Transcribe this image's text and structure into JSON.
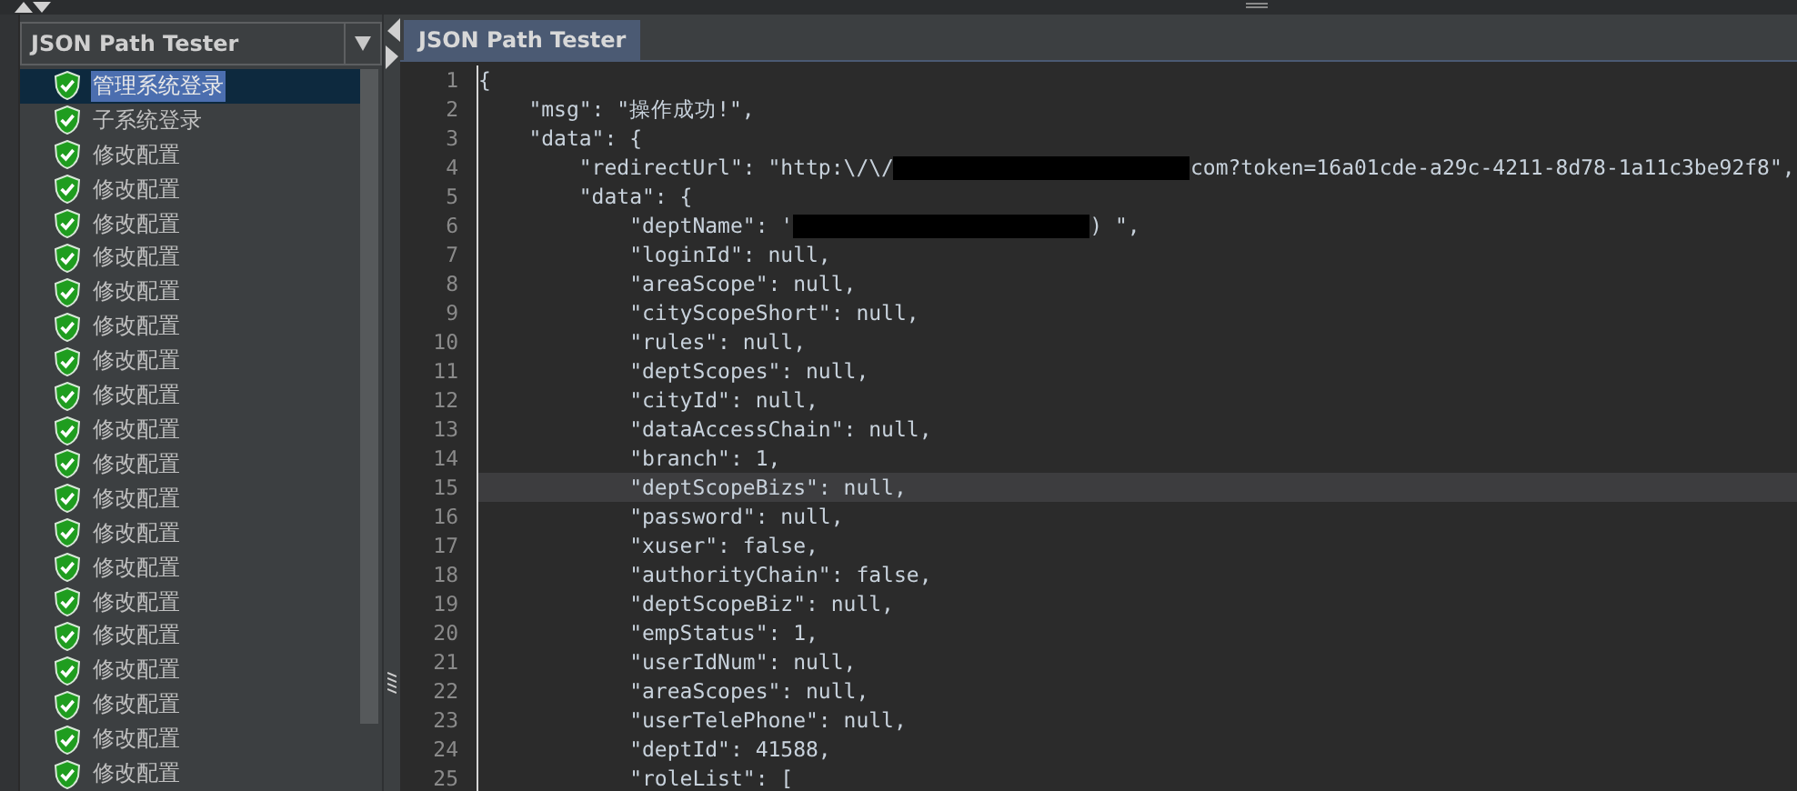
{
  "left_panel": {
    "dropdown": {
      "value": "JSON Path Tester"
    },
    "tree_items": [
      {
        "label": "管理系统登录",
        "selected": true
      },
      {
        "label": "子系统登录",
        "selected": false
      },
      {
        "label": "修改配置",
        "selected": false
      },
      {
        "label": "修改配置",
        "selected": false
      },
      {
        "label": "修改配置",
        "selected": false
      },
      {
        "label": "修改配置",
        "selected": false
      },
      {
        "label": "修改配置",
        "selected": false
      },
      {
        "label": "修改配置",
        "selected": false
      },
      {
        "label": "修改配置",
        "selected": false
      },
      {
        "label": "修改配置",
        "selected": false
      },
      {
        "label": "修改配置",
        "selected": false
      },
      {
        "label": "修改配置",
        "selected": false
      },
      {
        "label": "修改配置",
        "selected": false
      },
      {
        "label": "修改配置",
        "selected": false
      },
      {
        "label": "修改配置",
        "selected": false
      },
      {
        "label": "修改配置",
        "selected": false
      },
      {
        "label": "修改配置",
        "selected": false
      },
      {
        "label": "修改配置",
        "selected": false
      },
      {
        "label": "修改配置",
        "selected": false
      },
      {
        "label": "修改配置",
        "selected": false
      },
      {
        "label": "修改配置",
        "selected": false
      }
    ]
  },
  "tabs": [
    {
      "label": "JSON Path Tester",
      "selected": true
    }
  ],
  "editor": {
    "lines": [
      {
        "number": "1",
        "current": false,
        "parts": [
          {
            "kind": "text",
            "text": "{"
          }
        ]
      },
      {
        "number": "2",
        "current": false,
        "parts": [
          {
            "kind": "text",
            "text": "    \"msg\": \"操作成功!\","
          }
        ]
      },
      {
        "number": "3",
        "current": false,
        "parts": [
          {
            "kind": "text",
            "text": "    \"data\": {"
          }
        ]
      },
      {
        "number": "4",
        "current": false,
        "parts": [
          {
            "kind": "text",
            "text": "        \"redirectUrl\": \"http:\\/\\/"
          },
          {
            "kind": "redaction"
          },
          {
            "kind": "text",
            "text": "com?token=16a01cde-a29c-4211-8d78-1a11c3be92f8\","
          }
        ]
      },
      {
        "number": "5",
        "current": false,
        "parts": [
          {
            "kind": "text",
            "text": "        \"data\": {"
          }
        ]
      },
      {
        "number": "6",
        "current": false,
        "parts": [
          {
            "kind": "text",
            "text": "            \"deptName\": '"
          },
          {
            "kind": "redaction"
          },
          {
            "kind": "text",
            "text": ") \","
          }
        ]
      },
      {
        "number": "7",
        "current": false,
        "parts": [
          {
            "kind": "text",
            "text": "            \"loginId\": null,"
          }
        ]
      },
      {
        "number": "8",
        "current": false,
        "parts": [
          {
            "kind": "text",
            "text": "            \"areaScope\": null,"
          }
        ]
      },
      {
        "number": "9",
        "current": false,
        "parts": [
          {
            "kind": "text",
            "text": "            \"cityScopeShort\": null,"
          }
        ]
      },
      {
        "number": "10",
        "current": false,
        "parts": [
          {
            "kind": "text",
            "text": "            \"rules\": null,"
          }
        ]
      },
      {
        "number": "11",
        "current": false,
        "parts": [
          {
            "kind": "text",
            "text": "            \"deptScopes\": null,"
          }
        ]
      },
      {
        "number": "12",
        "current": false,
        "parts": [
          {
            "kind": "text",
            "text": "            \"cityId\": null,"
          }
        ]
      },
      {
        "number": "13",
        "current": false,
        "parts": [
          {
            "kind": "text",
            "text": "            \"dataAccessChain\": null,"
          }
        ]
      },
      {
        "number": "14",
        "current": false,
        "parts": [
          {
            "kind": "text",
            "text": "            \"branch\": 1,"
          }
        ]
      },
      {
        "number": "15",
        "current": true,
        "parts": [
          {
            "kind": "text",
            "text": "            \"deptScopeBizs\": null,"
          }
        ]
      },
      {
        "number": "16",
        "current": false,
        "parts": [
          {
            "kind": "text",
            "text": "            \"password\": null,"
          }
        ]
      },
      {
        "number": "17",
        "current": false,
        "parts": [
          {
            "kind": "text",
            "text": "            \"xuser\": false,"
          }
        ]
      },
      {
        "number": "18",
        "current": false,
        "parts": [
          {
            "kind": "text",
            "text": "            \"authorityChain\": false,"
          }
        ]
      },
      {
        "number": "19",
        "current": false,
        "parts": [
          {
            "kind": "text",
            "text": "            \"deptScopeBiz\": null,"
          }
        ]
      },
      {
        "number": "20",
        "current": false,
        "parts": [
          {
            "kind": "text",
            "text": "            \"empStatus\": 1,"
          }
        ]
      },
      {
        "number": "21",
        "current": false,
        "parts": [
          {
            "kind": "text",
            "text": "            \"userIdNum\": null,"
          }
        ]
      },
      {
        "number": "22",
        "current": false,
        "parts": [
          {
            "kind": "text",
            "text": "            \"areaScopes\": null,"
          }
        ]
      },
      {
        "number": "23",
        "current": false,
        "parts": [
          {
            "kind": "text",
            "text": "            \"userTelePhone\": null,"
          }
        ]
      },
      {
        "number": "24",
        "current": false,
        "parts": [
          {
            "kind": "text",
            "text": "            \"deptId\": 41588,"
          }
        ]
      },
      {
        "number": "25",
        "current": false,
        "parts": [
          {
            "kind": "text",
            "text": "            \"roleList\": ["
          }
        ]
      }
    ]
  }
}
